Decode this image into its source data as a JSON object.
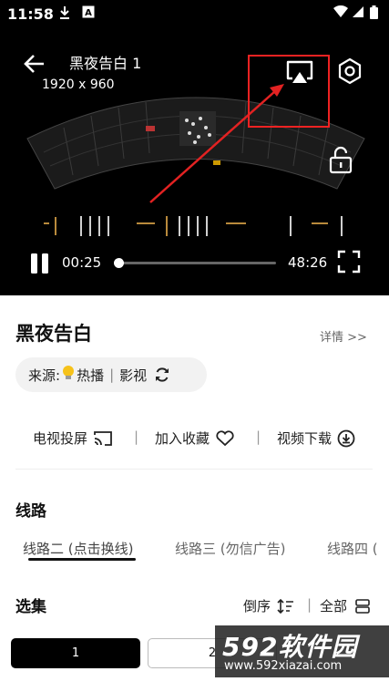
{
  "status_bar": {
    "time": "11:58",
    "download_icon": "download-icon",
    "a_icon": "A"
  },
  "player": {
    "title": "黑夜告白 1",
    "resolution": "1920 x 960",
    "current_time": "00:25",
    "total_time": "48:26",
    "progress": 0.0086
  },
  "show": {
    "title": "黑夜告白",
    "details_label": "详情 >>",
    "source_label": "来源:",
    "source_name": "热播",
    "source_type": "影视",
    "source_sep": "|"
  },
  "actions": {
    "cast": "电视投屏",
    "favorite": "加入收藏",
    "download": "视频下载",
    "sep": "|"
  },
  "lines": {
    "heading": "线路",
    "tabs": [
      {
        "label": "线路二 (点击换线)",
        "active": true
      },
      {
        "label": "线路三 (勿信广告)",
        "active": false
      },
      {
        "label": "线路四 (",
        "active": false
      }
    ]
  },
  "episodes": {
    "heading": "选集",
    "sort_label": "倒序",
    "all_label": "全部",
    "sep": "|",
    "items": [
      "1",
      "2"
    ]
  },
  "watermark": {
    "brand": "592软件园",
    "url": "www.592xiazai.com"
  },
  "colors": {
    "accent_red": "#e22222",
    "player_bg": "#000000",
    "pill_bg": "#f2f2f2"
  }
}
